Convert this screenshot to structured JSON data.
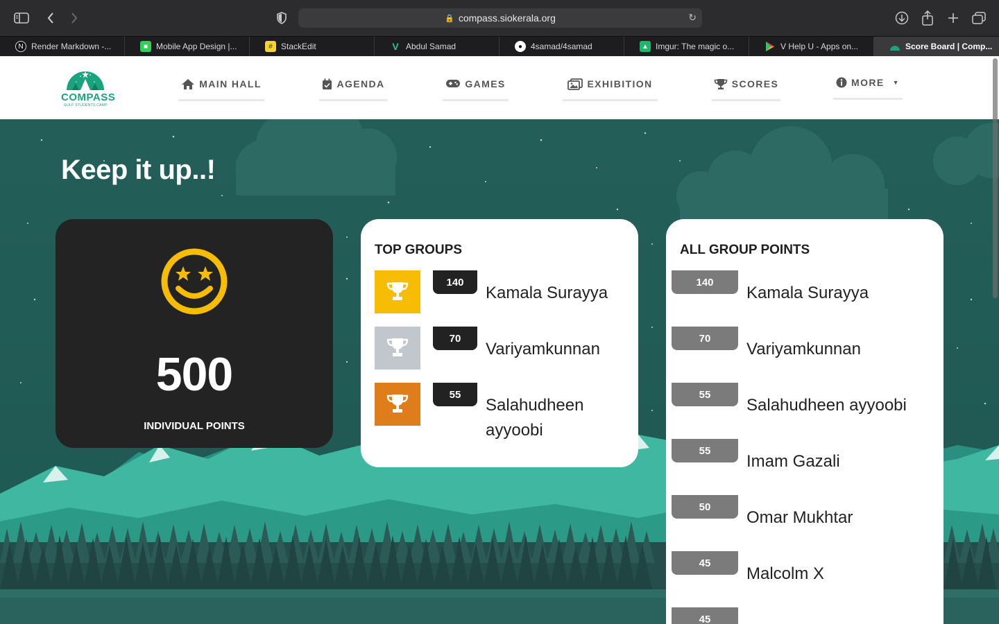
{
  "browser": {
    "url": "compass.siokerala.org",
    "tabs": [
      {
        "label": "Render Markdown -...",
        "color": "#ffffff"
      },
      {
        "label": "Mobile App Design |...",
        "color": "#2fcf5a"
      },
      {
        "label": "StackEdit",
        "color": "#f5d13b"
      },
      {
        "label": "Abdul Samad",
        "color": "#24c78e"
      },
      {
        "label": "4samad/4samad",
        "color": "#ffffff"
      },
      {
        "label": "Imgur: The magic o...",
        "color": "#1bb76e"
      },
      {
        "label": "V Help U - Apps on...",
        "color": "#3d8ef0"
      },
      {
        "label": "Score Board | Comp...",
        "color": "#1ba37f"
      }
    ]
  },
  "site": {
    "logo_text": "COMPASS",
    "logo_subtext": "GULF STUDENTS CAMP",
    "nav": [
      {
        "label": "MAIN HALL",
        "icon": "home-icon"
      },
      {
        "label": "AGENDA",
        "icon": "calendar-icon"
      },
      {
        "label": "GAMES",
        "icon": "gamepad-icon"
      },
      {
        "label": "EXHIBITION",
        "icon": "images-icon"
      },
      {
        "label": "SCORES",
        "icon": "trophy-icon"
      },
      {
        "label": "MORE",
        "icon": "info-icon"
      }
    ]
  },
  "main": {
    "headline": "Keep it up..!",
    "individual": {
      "points": "500",
      "label": "INDIVIDUAL POINTS",
      "icon": "star-struck-face-icon"
    },
    "top_groups": {
      "title": "TOP GROUPS",
      "items": [
        {
          "points": "140",
          "name": "Kamala Surayya",
          "color": "#f7bd05"
        },
        {
          "points": "70",
          "name": "Variyamkunnan",
          "color": "#c2c6cd"
        },
        {
          "points": "55",
          "name": "Salahudheen ayyoobi",
          "color": "#de7d1a"
        }
      ]
    },
    "all_groups": {
      "title": "ALL GROUP POINTS",
      "items": [
        {
          "points": "140",
          "name": "Kamala Surayya"
        },
        {
          "points": "70",
          "name": "Variyamkunnan"
        },
        {
          "points": "55",
          "name": "Salahudheen ayyoobi"
        },
        {
          "points": "55",
          "name": "Imam Gazali"
        },
        {
          "points": "50",
          "name": "Omar Mukhtar"
        },
        {
          "points": "45",
          "name": "Malcolm X"
        },
        {
          "points": "45",
          "name": ""
        }
      ]
    }
  }
}
